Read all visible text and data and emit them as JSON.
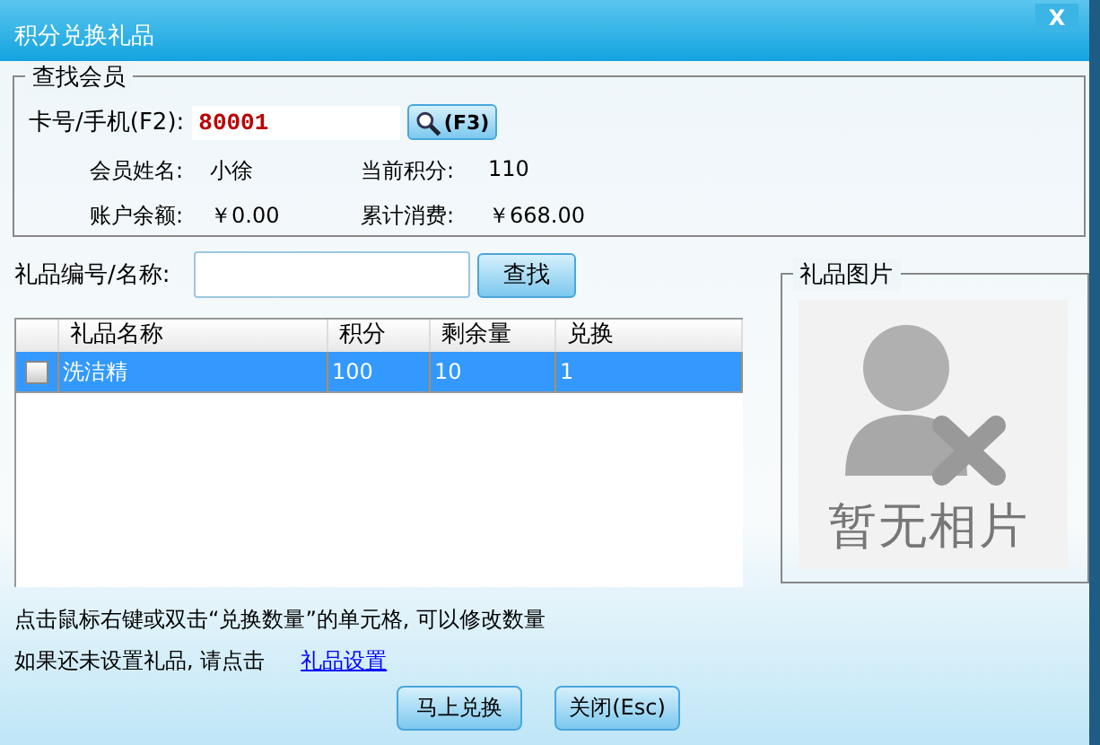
{
  "window": {
    "title": "积分兑换礼品",
    "close": "X"
  },
  "member_search": {
    "legend": "查找会员",
    "card_label": "卡号/手机(F2):",
    "card_value": "80001",
    "search_button": "(F3)",
    "info": [
      {
        "label": "会员姓名:",
        "value": "小徐"
      },
      {
        "label": "当前积分:",
        "value": "110"
      },
      {
        "label": "账户余额:",
        "value": "￥0.00"
      },
      {
        "label": "累计消费:",
        "value": "￥668.00"
      }
    ]
  },
  "gift_search": {
    "label": "礼品编号/名称:",
    "button": "查找"
  },
  "table": {
    "columns": [
      "礼品名称",
      "积分",
      "剩余量",
      "兑换"
    ],
    "rows": [
      {
        "checked": false,
        "selected": true,
        "cells": [
          "洗洁精",
          "100",
          "10",
          "1"
        ]
      }
    ]
  },
  "gift_picture": {
    "legend": "礼品图片",
    "placeholder_text": "暂无相片"
  },
  "notes": {
    "hint": "点击鼠标右键或双击“兑换数量”的单元格, 可以修改数量",
    "setup_text": "如果还未设置礼品, 请点击",
    "setup_link": "礼品设置"
  },
  "buttons": [
    "马上兑换",
    "关闭(Esc)"
  ]
}
